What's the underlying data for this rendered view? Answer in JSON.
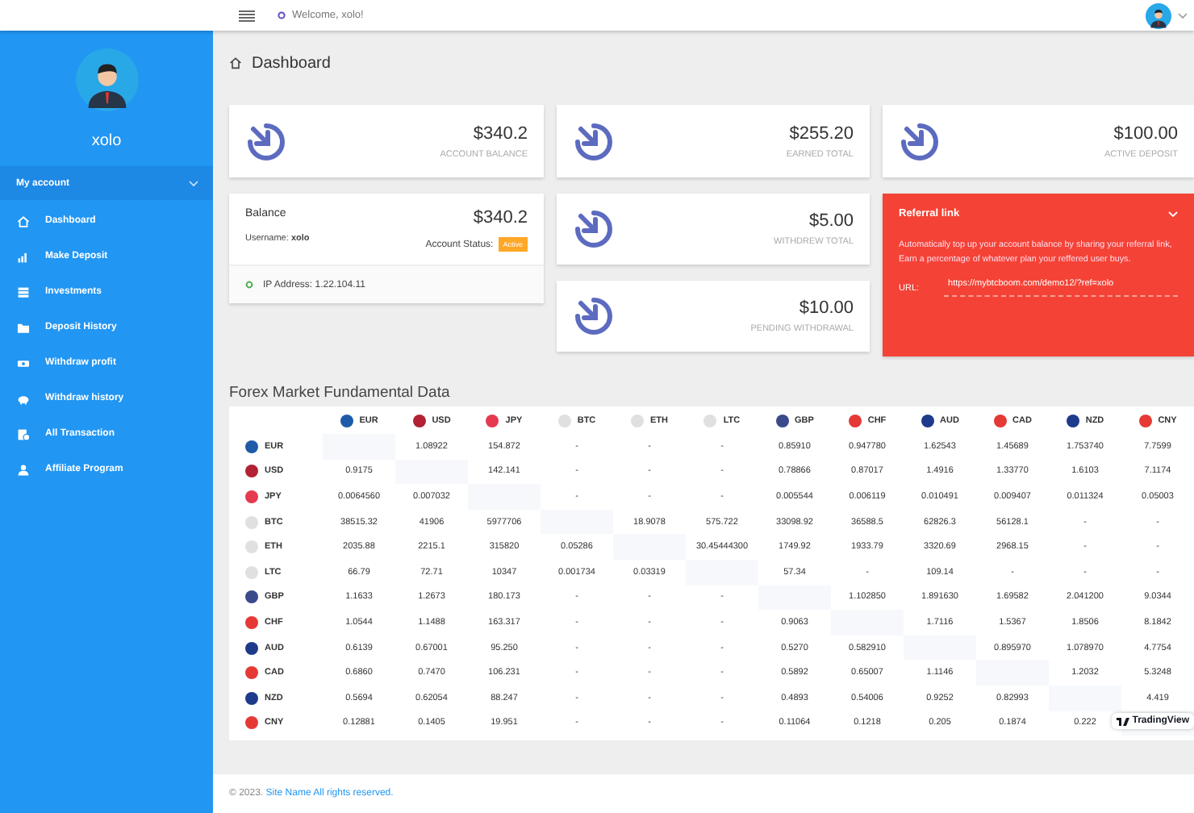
{
  "topbar": {
    "welcome": "Welcome, xolo!"
  },
  "sidebar": {
    "username": "xolo",
    "section": {
      "label": "My account",
      "expanded": true
    },
    "items": [
      {
        "label": "Dashboard"
      },
      {
        "label": "Make Deposit"
      },
      {
        "label": "Investments"
      },
      {
        "label": "Deposit History"
      },
      {
        "label": "Withdraw profit"
      },
      {
        "label": "Withdraw history"
      },
      {
        "label": "All Transaction"
      },
      {
        "label": "Affiliate Program"
      }
    ]
  },
  "page_title": "Dashboard",
  "stats": [
    {
      "amount": "$340.2",
      "label": "ACCOUNT BALANCE"
    },
    {
      "amount": "$255.20",
      "label": "EARNED TOTAL"
    },
    {
      "amount": "$100.00",
      "label": "ACTIVE DEPOSIT"
    },
    {
      "amount": "$5.00",
      "label": "WITHDREW TOTAL"
    },
    {
      "amount": "$10.00",
      "label": "PENDING WITHDRAWAL"
    }
  ],
  "balance": {
    "title": "Balance",
    "amount": "$340.2",
    "username": "Username: **xolo**",
    "status_label": "Account Status:",
    "status": "Active",
    "ip": "IP Address: 1.22.104.11"
  },
  "referral": {
    "title": "Referral link",
    "expanded": true,
    "text": "Automatically top up your account balance by sharing your referral link, Earn a percentage of whatever plan your reffered user buys.",
    "url_label": "URL:",
    "url": "https://mybtcboom.com/demo12/?ref=xolo"
  },
  "forex": {
    "title": "Forex Market Fundamental Data",
    "badge": "TradingView",
    "columns": [
      {
        "code": "EUR",
        "color": "#1e5aa8"
      },
      {
        "code": "USD",
        "color": "#b22234"
      },
      {
        "code": "JPY",
        "color": "#e53950"
      },
      {
        "code": "BTC",
        "color": "#e0e0e0"
      },
      {
        "code": "ETH",
        "color": "#e0e0e0"
      },
      {
        "code": "LTC",
        "color": "#e0e0e0"
      },
      {
        "code": "GBP",
        "color": "#3a4a8a"
      },
      {
        "code": "CHF",
        "color": "#e53935"
      },
      {
        "code": "AUD",
        "color": "#1e3a8a"
      },
      {
        "code": "CAD",
        "color": "#e53935"
      },
      {
        "code": "NZD",
        "color": "#1e3a8a"
      },
      {
        "code": "CNY",
        "color": "#e53935"
      }
    ],
    "rows": [
      {
        "code": "EUR",
        "color": "#1e5aa8",
        "values": [
          "1.08922",
          "154.872",
          "-",
          "-",
          "-",
          "0.85910",
          "0.947780",
          "1.62543",
          "1.45689",
          "1.753740",
          "7.7599"
        ]
      },
      {
        "code": "USD",
        "color": "#b22234",
        "values": [
          "0.9175",
          "142.141",
          "-",
          "-",
          "-",
          "0.78866",
          "0.87017",
          "1.4916",
          "1.33770",
          "1.6103",
          "7.1174"
        ]
      },
      {
        "code": "JPY",
        "color": "#e53950",
        "values": [
          "0.0064560",
          "0.007032",
          "-",
          "-",
          "-",
          "0.005544",
          "0.006119",
          "0.010491",
          "0.009407",
          "0.011324",
          "0.05003"
        ]
      },
      {
        "code": "BTC",
        "color": "#e0e0e0",
        "values": [
          "38515.32",
          "41906",
          "5977706",
          "18.9078",
          "575.722",
          "33098.92",
          "36588.5",
          "62826.3",
          "56128.1",
          "-",
          "-"
        ]
      },
      {
        "code": "ETH",
        "color": "#e0e0e0",
        "values": [
          "2035.88",
          "2215.1",
          "315820",
          "0.05286",
          "30.45444300",
          "1749.92",
          "1933.79",
          "3320.69",
          "2968.15",
          "-",
          "-"
        ]
      },
      {
        "code": "LTC",
        "color": "#e0e0e0",
        "values": [
          "66.79",
          "72.71",
          "10347",
          "0.001734",
          "0.03319",
          "57.34",
          "-",
          "109.14",
          "-",
          "-",
          "-"
        ]
      },
      {
        "code": "GBP",
        "color": "#3a4a8a",
        "values": [
          "1.1633",
          "1.2673",
          "180.173",
          "-",
          "-",
          "-",
          "1.102850",
          "1.891630",
          "1.69582",
          "2.041200",
          "9.0344"
        ]
      },
      {
        "code": "CHF",
        "color": "#e53935",
        "values": [
          "1.0544",
          "1.1488",
          "163.317",
          "-",
          "-",
          "-",
          "0.9063",
          "1.7116",
          "1.5367",
          "1.8506",
          "8.1842"
        ]
      },
      {
        "code": "AUD",
        "color": "#1e3a8a",
        "values": [
          "0.6139",
          "0.67001",
          "95.250",
          "-",
          "-",
          "-",
          "0.5270",
          "0.582910",
          "0.895970",
          "1.078970",
          "4.7754"
        ]
      },
      {
        "code": "CAD",
        "color": "#e53935",
        "values": [
          "0.6860",
          "0.7470",
          "106.231",
          "-",
          "-",
          "-",
          "0.5892",
          "0.65007",
          "1.1146",
          "1.2032",
          "5.3248"
        ]
      },
      {
        "code": "NZD",
        "color": "#1e3a8a",
        "values": [
          "0.5694",
          "0.62054",
          "88.247",
          "-",
          "-",
          "-",
          "0.4893",
          "0.54006",
          "0.9252",
          "0.82993",
          "4.419"
        ]
      },
      {
        "code": "CNY",
        "color": "#e53935",
        "values": [
          "0.12881",
          "0.1405",
          "19.951",
          "-",
          "-",
          "-",
          "0.11064",
          "0.1218",
          "0.205",
          "0.1874",
          "0.222"
        ]
      }
    ]
  },
  "footer": {
    "text": "© 2023. ",
    "link": "Site Name All rights reserved."
  }
}
